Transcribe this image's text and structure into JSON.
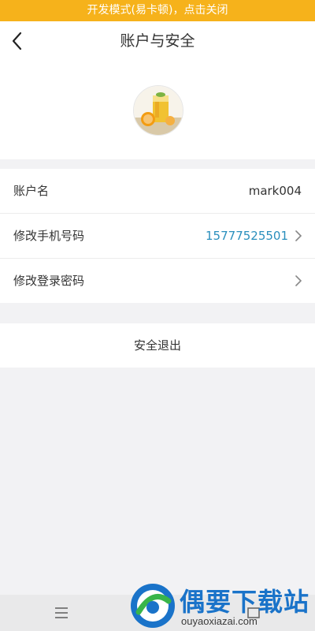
{
  "dev_banner": "开发模式(易卡顿)，点击关闭",
  "header": {
    "title": "账户与安全"
  },
  "rows": [
    {
      "label": "账户名",
      "value": "mark004"
    },
    {
      "label": "修改手机号码",
      "value": "15777525501"
    },
    {
      "label": "修改登录密码",
      "value": ""
    }
  ],
  "logout_label": "安全退出",
  "watermark": {
    "brand": "偶要下载站",
    "url": "ouyaoxiazai.com"
  },
  "colors": {
    "banner": "#f6b21b",
    "phone": "#2a8fbd",
    "background": "#f2f2f4"
  }
}
